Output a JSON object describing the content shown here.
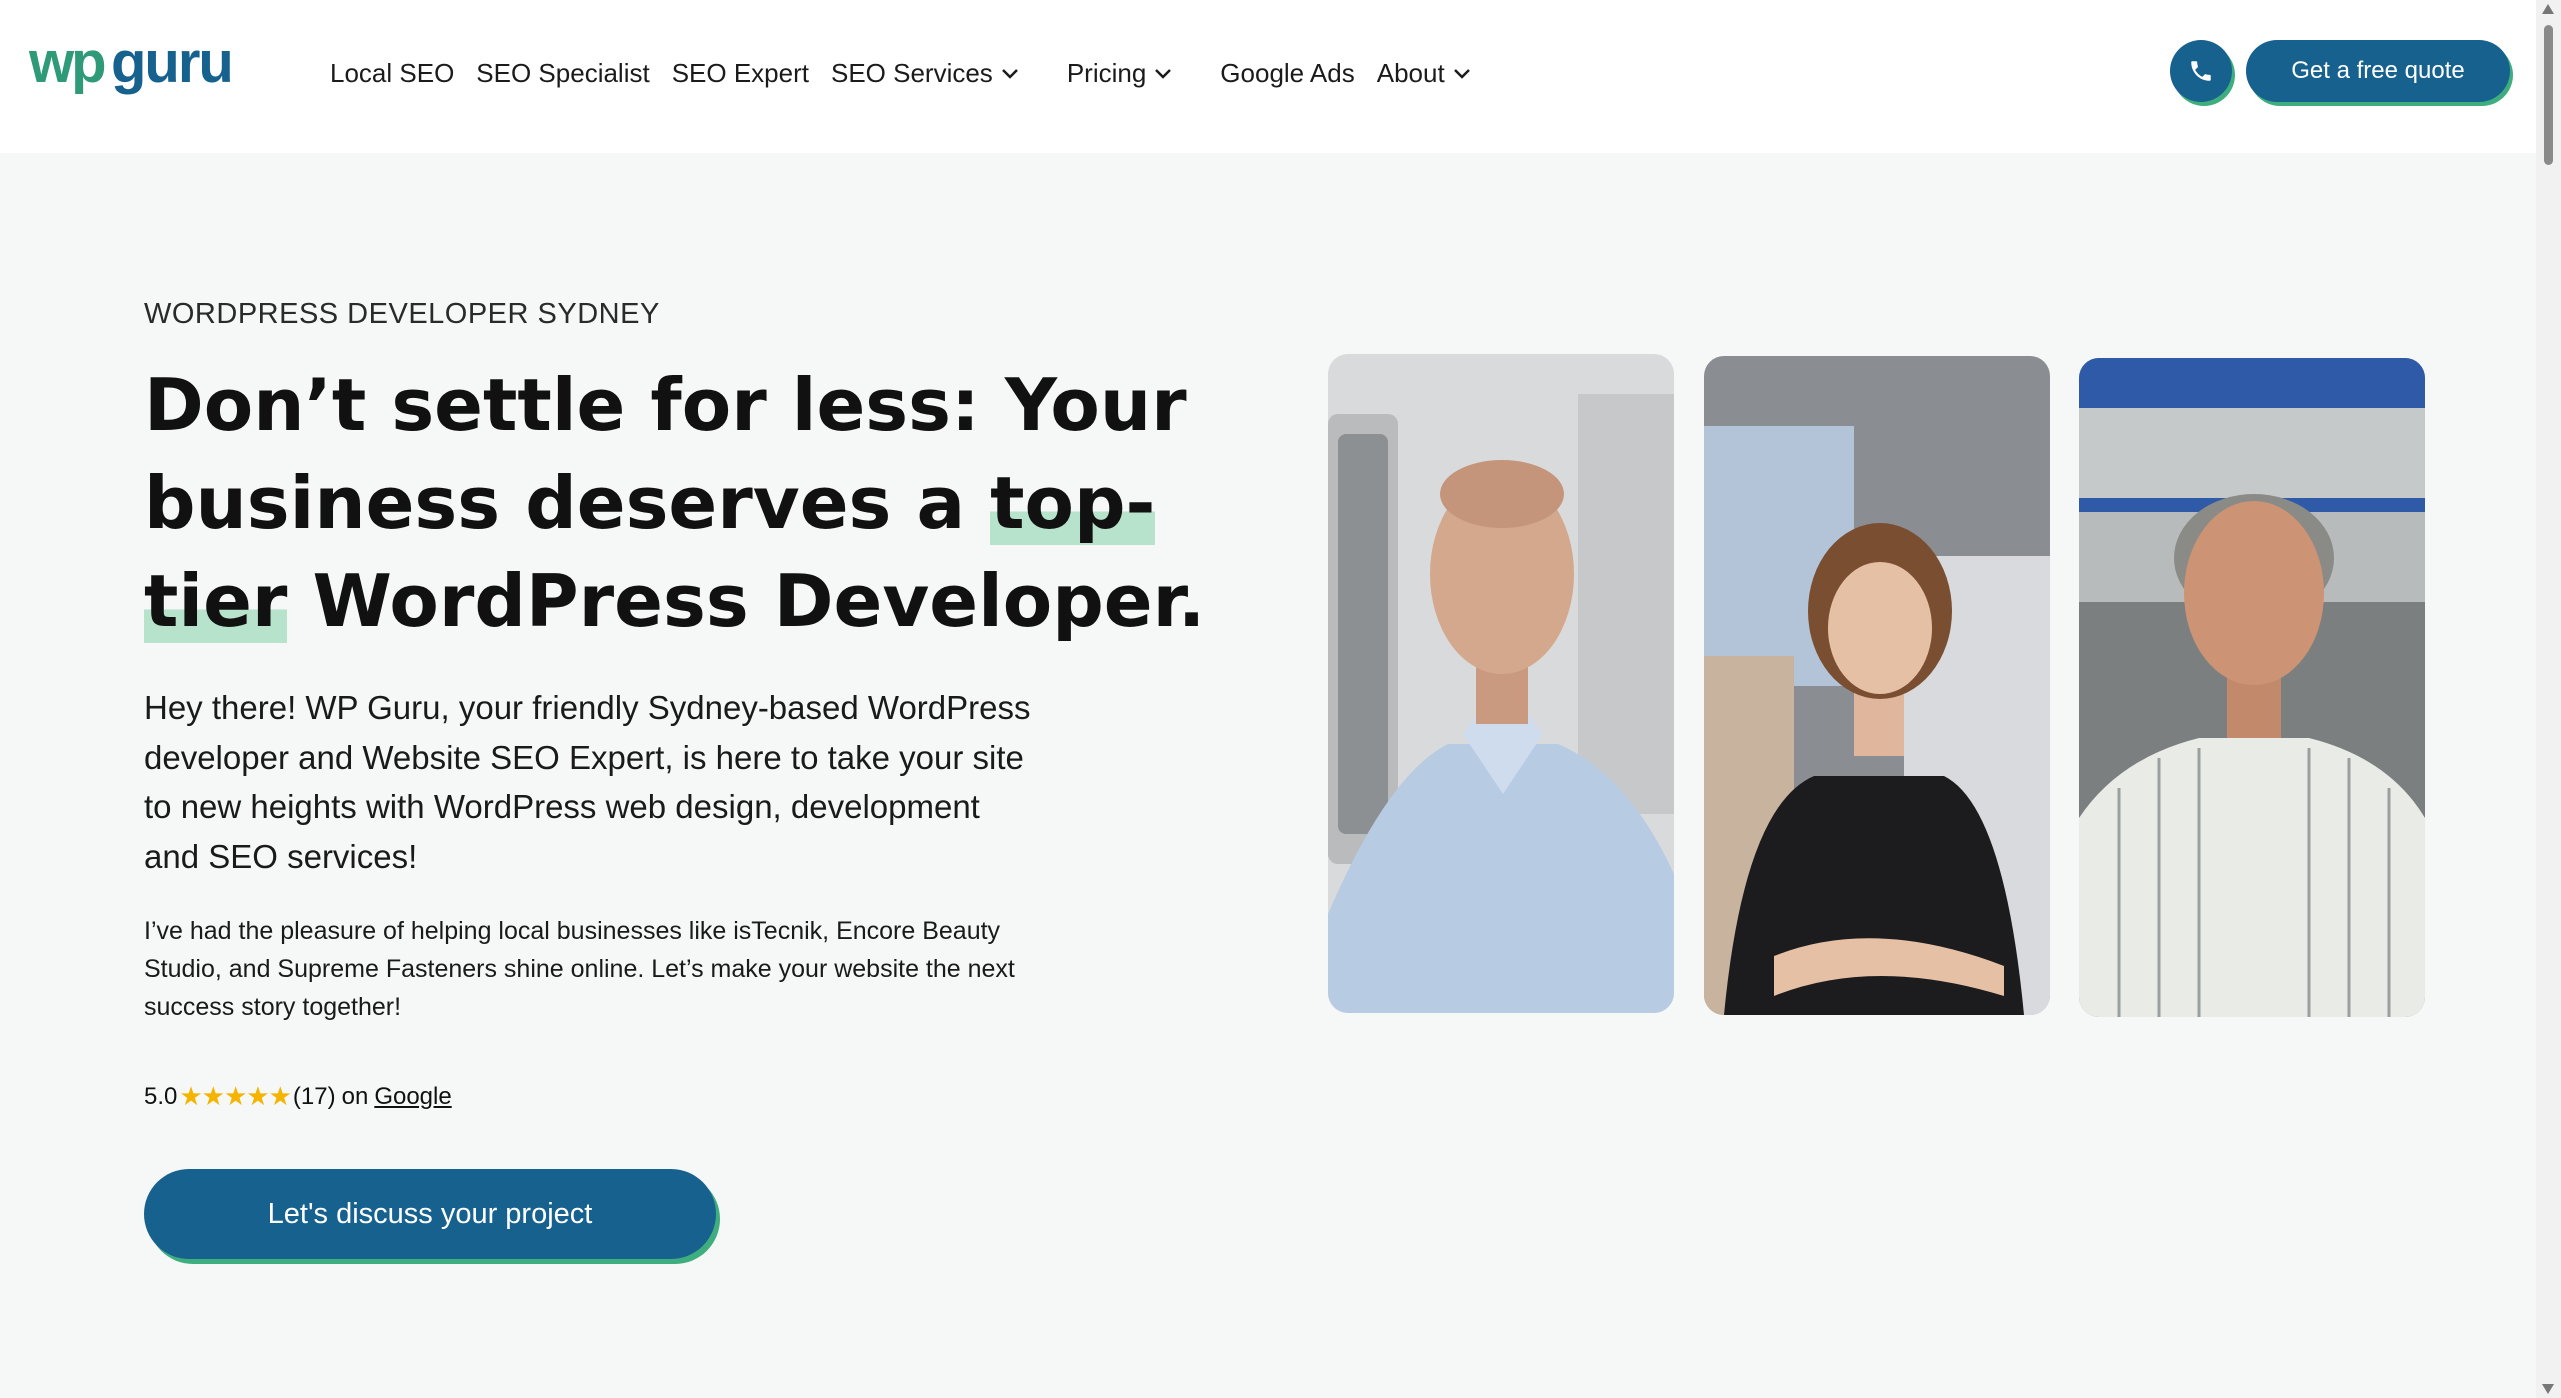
{
  "header": {
    "logo_text": "wpguru",
    "nav": [
      {
        "label": "Local SEO",
        "dropdown": false
      },
      {
        "label": "SEO Specialist",
        "dropdown": false
      },
      {
        "label": "SEO Expert",
        "dropdown": false
      },
      {
        "label": "SEO Services",
        "dropdown": true
      },
      {
        "label": "Pricing",
        "dropdown": true
      },
      {
        "label": "Google Ads",
        "dropdown": false
      },
      {
        "label": "About",
        "dropdown": true
      }
    ],
    "phone_icon": "phone-icon",
    "quote_button": "Get a free quote"
  },
  "hero": {
    "eyebrow": "WORDPRESS DEVELOPER SYDNEY",
    "headline_part1": "Don’t settle for less: Your business deserves a ",
    "headline_highlight": "top-tier",
    "headline_part2": " WordPress Developer.",
    "intro": "Hey there! WP Guru, your friendly Sydney-based WordPress developer and Website SEO Expert, is here to take your site to new heights with WordPress web design, development and SEO services!",
    "body": "I’ve had the pleasure of helping local businesses like isTecnik, Encore Beauty Studio, and Supreme Fasteners shine online. Let’s make your website the next success story together!",
    "rating": {
      "score": "5.0",
      "stars": "★★★★★",
      "count": "(17)",
      "on_text": "on",
      "source": "Google"
    },
    "cta": "Let's discuss your project"
  },
  "colors": {
    "brand_blue": "#17618f",
    "brand_green": "#3fae7e",
    "highlight": "#b7e2cc",
    "star": "#f5b400"
  }
}
